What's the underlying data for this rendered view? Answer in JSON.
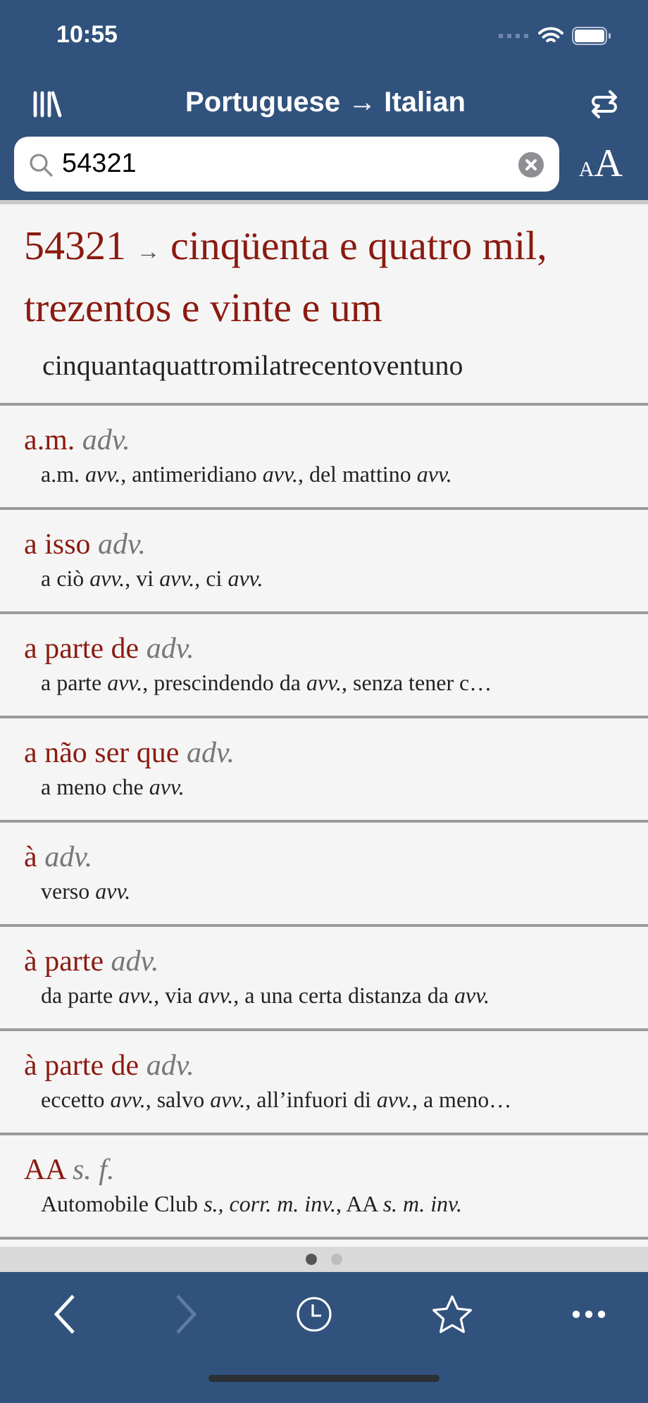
{
  "status_bar": {
    "time": "10:55"
  },
  "nav_bar": {
    "title": "Portuguese → Italian"
  },
  "search": {
    "value": "54321",
    "font_size_small": "A",
    "font_size_large": "A"
  },
  "result": {
    "term": "54321",
    "arrow": "→",
    "translation": "cinqüenta e quatro mil, trezentos e vinte e um",
    "target": "cinquantaquattromilatrecentoventuno"
  },
  "entries": [
    {
      "term": "a.m.",
      "pos": "adv.",
      "translation": "a.m. *avv.*, antimeridiano *avv.*, del mattino *avv.*"
    },
    {
      "term": "a isso",
      "pos": "adv.",
      "translation": "a ciò *avv.*, vi *avv.*, ci *avv.*"
    },
    {
      "term": "a parte de",
      "pos": "adv.",
      "translation": "a parte *avv.*, prescindendo da *avv.*, senza tener c…"
    },
    {
      "term": "a não ser que",
      "pos": "adv.",
      "translation": "a meno che *avv.*"
    },
    {
      "term": "à",
      "pos": "adv.",
      "translation": "verso *avv.*"
    },
    {
      "term": "à parte",
      "pos": "adv.",
      "translation": "da parte *avv.*, via *avv.*, a una certa distanza da *avv.*"
    },
    {
      "term": "à parte de",
      "pos": "adv.",
      "translation": "eccetto *avv.*, salvo *avv.*, all’infuori di *avv.*, a meno…"
    },
    {
      "term": "AA",
      "pos": "s. f.",
      "translation": "Automobile Club *s., corr. m. inv.*, AA *s. m. inv.*"
    }
  ],
  "page_dots": [
    {
      "selected": true
    },
    {
      "selected": false
    }
  ],
  "toolbar": [
    {
      "kind": "back",
      "disabled": false
    },
    {
      "kind": "forward",
      "disabled": true
    },
    {
      "kind": "history",
      "disabled": false
    },
    {
      "kind": "favorites",
      "disabled": false
    },
    {
      "kind": "more",
      "disabled": false
    }
  ]
}
